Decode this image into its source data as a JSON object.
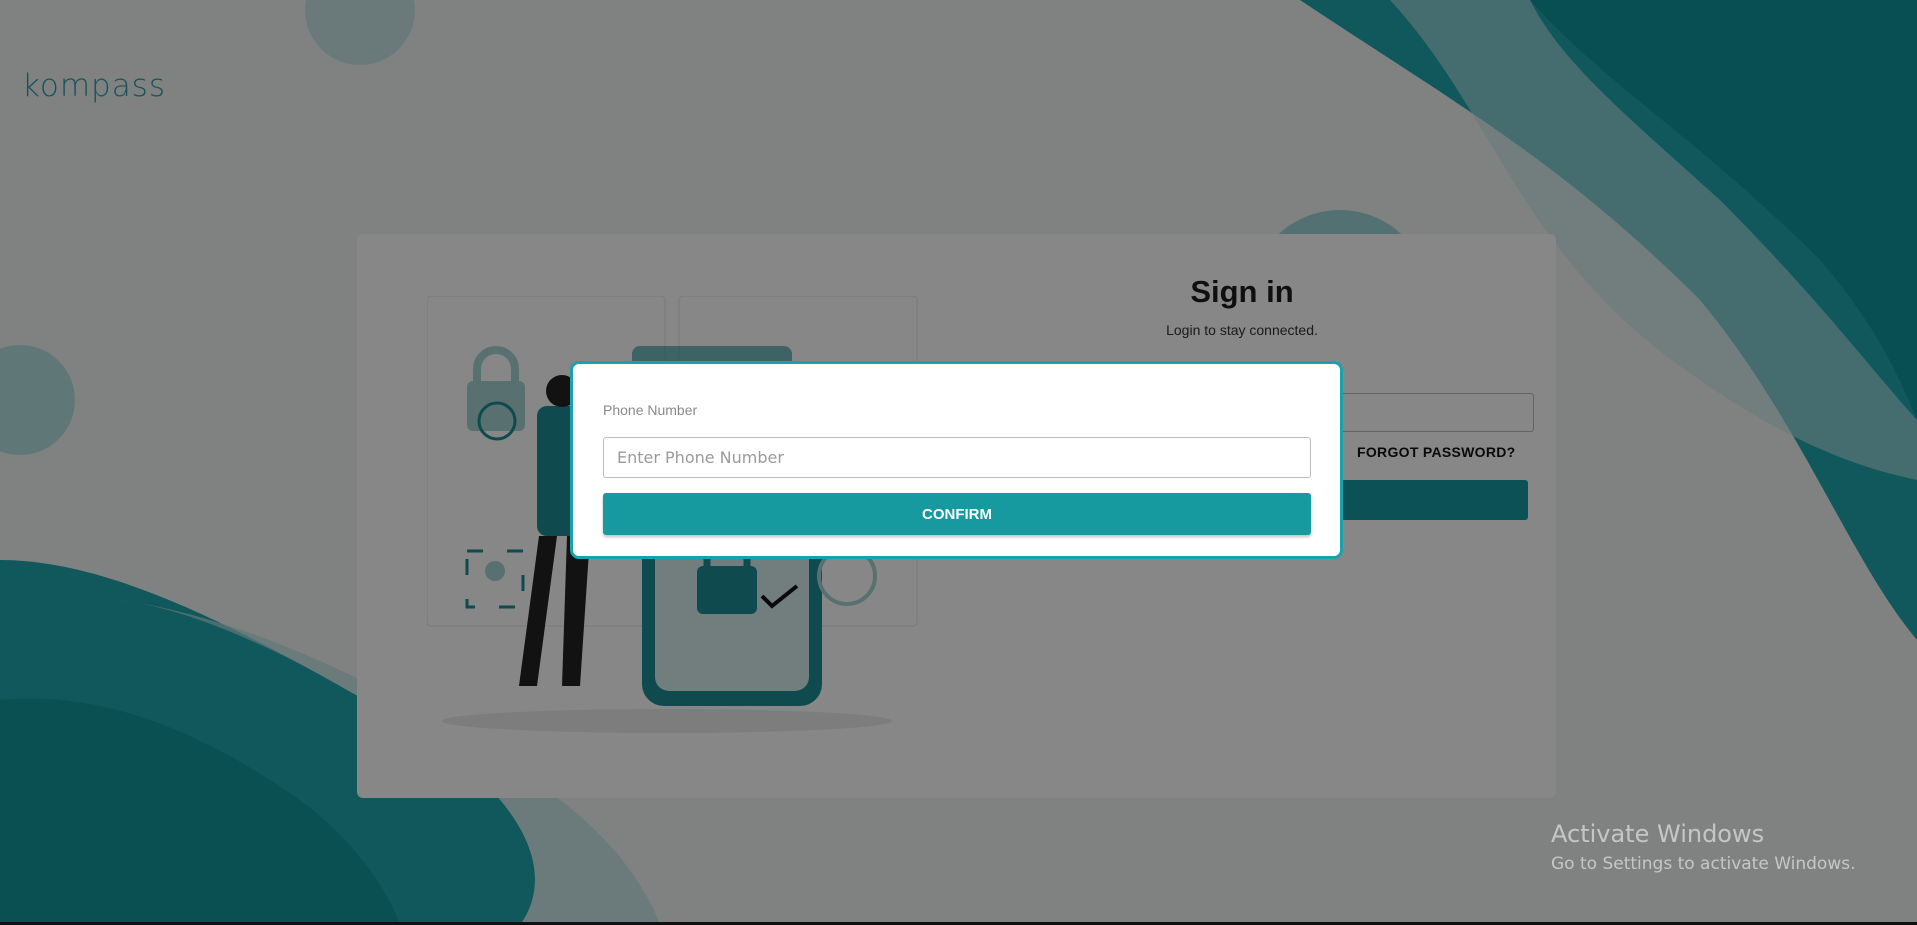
{
  "brand": {
    "logo_text": "kompass",
    "accent_color": "#17a2ad"
  },
  "signin": {
    "title": "Sign in",
    "subtitle": "Login to stay connected.",
    "forgot_label": "FORGOT PASSWORD?"
  },
  "modal": {
    "label": "Phone Number",
    "input_placeholder": "Enter Phone Number",
    "input_value": "",
    "confirm_label": "CONFIRM"
  },
  "watermark": {
    "line1": "Activate Windows",
    "line2": "Go to Settings to activate Windows."
  }
}
